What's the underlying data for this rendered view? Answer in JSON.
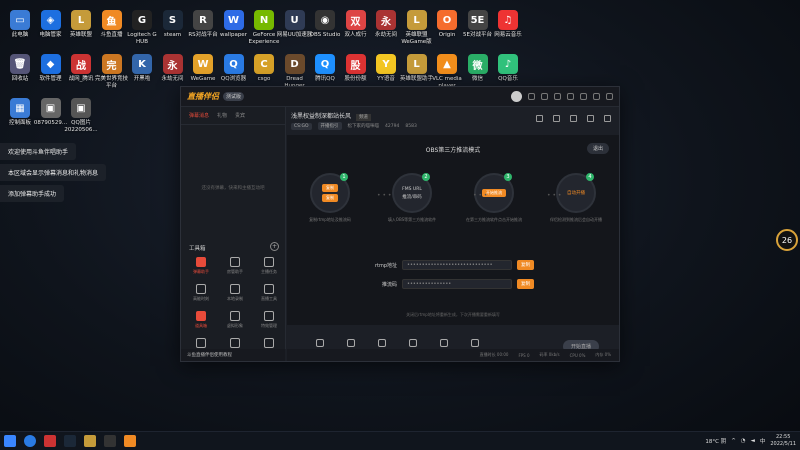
{
  "desktop": {
    "icons": [
      {
        "label": "此电脑",
        "color": "#3a7bd5",
        "glyph": "▭"
      },
      {
        "label": "电脑管家",
        "color": "#1d6fe0",
        "glyph": "◈"
      },
      {
        "label": "英雄联盟",
        "color": "#c59b3a",
        "glyph": "L"
      },
      {
        "label": "斗鱼直播",
        "color": "#f08a24",
        "glyph": "鱼"
      },
      {
        "label": "Logitech G HUB",
        "color": "#222",
        "glyph": "G"
      },
      {
        "label": "steam",
        "color": "#1b2838",
        "glyph": "S"
      },
      {
        "label": "RS对战平台",
        "color": "#444",
        "glyph": "R"
      },
      {
        "label": "wallpaper",
        "color": "#2e6be6",
        "glyph": "W"
      },
      {
        "label": "GeForce Experience",
        "color": "#76b900",
        "glyph": "N"
      },
      {
        "label": "网易UU加速器",
        "color": "#2f3b55",
        "glyph": "U"
      },
      {
        "label": "OBS Studio",
        "color": "#333",
        "glyph": "◉"
      },
      {
        "label": "双人成行",
        "color": "#d44",
        "glyph": "双"
      },
      {
        "label": "永劫无间",
        "color": "#a33",
        "glyph": "永"
      },
      {
        "label": "英雄联盟WeGame版",
        "color": "#c59b3a",
        "glyph": "L"
      },
      {
        "label": "Origin",
        "color": "#f56c2d",
        "glyph": "O"
      },
      {
        "label": "5E对战平台",
        "color": "#444",
        "glyph": "5E"
      },
      {
        "label": "网易云音乐",
        "color": "#e33",
        "glyph": "♫"
      },
      {
        "label": "回收站",
        "color": "#557",
        "glyph": "🗑"
      },
      {
        "label": "软件管理",
        "color": "#1d6fe0",
        "glyph": "◆"
      },
      {
        "label": "战网_腾讯",
        "color": "#c33",
        "glyph": "战"
      },
      {
        "label": "完美世界竞技平台",
        "color": "#c72",
        "glyph": "完"
      },
      {
        "label": "开黑啦",
        "color": "#36a",
        "glyph": "K"
      },
      {
        "label": "永劫无间",
        "color": "#a33",
        "glyph": "永"
      },
      {
        "label": "WeGame",
        "color": "#e4a22a",
        "glyph": "W"
      },
      {
        "label": "QQ浏览器",
        "color": "#2a7be4",
        "glyph": "Q"
      },
      {
        "label": "csgo",
        "color": "#d6a128",
        "glyph": "C"
      },
      {
        "label": "Dread Hunger",
        "color": "#6b4a2c",
        "glyph": "D"
      },
      {
        "label": "腾讯QQ",
        "color": "#1e90ff",
        "glyph": "Q"
      },
      {
        "label": "股份份额",
        "color": "#d33",
        "glyph": "股"
      },
      {
        "label": "YY语音",
        "color": "#f3c623",
        "glyph": "Y"
      },
      {
        "label": "英雄联盟助手",
        "color": "#c59b3a",
        "glyph": "L"
      },
      {
        "label": "VLC media player",
        "color": "#f28e1c",
        "glyph": "▲"
      },
      {
        "label": "微信",
        "color": "#2aae67",
        "glyph": "微"
      },
      {
        "label": "QQ音乐",
        "color": "#31c27c",
        "glyph": "♪"
      },
      {
        "label": "控制面板",
        "color": "#3a7bd5",
        "glyph": "▦"
      },
      {
        "label": "08790529...",
        "color": "#666",
        "glyph": "▣"
      },
      {
        "label": "QQ图片20220506...",
        "color": "#555",
        "glyph": "▣"
      }
    ]
  },
  "toasts": [
    "欢迎使用斗鱼伴唱助手",
    "本区域会显示弹幕消息和礼物消息",
    "添加弹幕助手成功"
  ],
  "window": {
    "logo": "直播伴侣",
    "version": "测试版",
    "left_tabs": [
      "弹幕消息",
      "礼物",
      "贵宾"
    ],
    "left_empty": "还没有弹幕，快来和主播互动吧",
    "tools_title": "工具箱",
    "tools": [
      {
        "label": "弹幕助手",
        "active": true
      },
      {
        "label": "房管助手",
        "active": false
      },
      {
        "label": "主播任务",
        "active": false
      },
      {
        "label": "高能时刻",
        "active": false
      },
      {
        "label": "本地录制",
        "active": false
      },
      {
        "label": "直播工具",
        "active": false
      },
      {
        "label": "道具箱",
        "active": true
      },
      {
        "label": "虚拟形象",
        "active": false
      },
      {
        "label": "特效管理",
        "active": false
      },
      {
        "label": "…",
        "active": false
      },
      {
        "label": "…",
        "active": false
      },
      {
        "label": "…",
        "active": false
      }
    ],
    "left_bottom": "斗鱼直播伴侣使用教程",
    "room": {
      "title": "浅黑权益制深都站长风",
      "tag": "频道",
      "game": "CS:GO",
      "pill": "开播指引",
      "streamer": "松下家的喵咪喵",
      "viewers": "42794",
      "fans": "8583"
    },
    "mode_title": "OBS第三方推流模式",
    "exit_label": "退出",
    "steps": [
      {
        "num": "1",
        "lines": [
          "复制",
          "复制"
        ],
        "desc": "复制rtmp地址及推流码"
      },
      {
        "num": "2",
        "lines": [
          "FMS URL",
          "推流/串码"
        ],
        "desc": "填入OBS等第三方推流软件"
      },
      {
        "num": "3",
        "lines": [
          "开始推流"
        ],
        "desc": "在第三方推流软件点击开始推流"
      },
      {
        "num": "4",
        "lines": [
          "自动开播"
        ],
        "desc": "伴侣检测到推流后会自动开播"
      }
    ],
    "rtmp_label": "rtmp地址",
    "rtmp_value": "•••••••••••••••••••••••••••••",
    "key_label": "推流码",
    "key_value": "•••••••••••••••",
    "copy_label": "复制",
    "hint": "关闭后rtmp地址将重新生成，下次开播需要重新填写",
    "toolbar": [
      "直播画面",
      "摄像头",
      "手机投屏",
      "多媒体",
      "麦克风",
      "扬声器"
    ],
    "go_live": "开始直播",
    "status": [
      "直播时长 00:00",
      "FPS 0",
      "码率 0kb/s",
      "CPU 0%",
      "内存 0%"
    ]
  },
  "ring": {
    "value": "26"
  },
  "taskbar": {
    "weather": "18°C 阴",
    "time": "22:55",
    "date": "2022/5/11",
    "lang": "中"
  }
}
